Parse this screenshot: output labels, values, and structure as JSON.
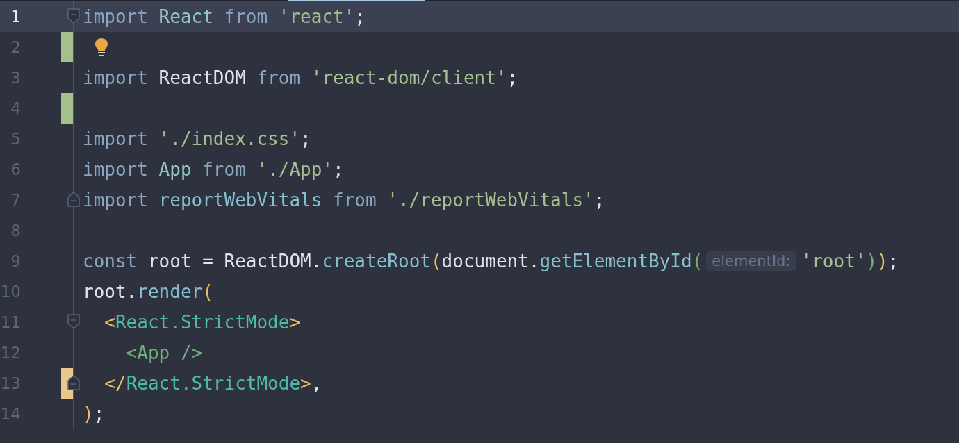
{
  "lines": [
    {
      "number": "1",
      "current": true,
      "fold_start": true,
      "fold_end": false,
      "bulb": false,
      "tokens": [
        {
          "text": "import",
          "kind": "keyword"
        },
        {
          "text": " React",
          "kind": "type"
        },
        {
          "text": " from",
          "kind": "keyword"
        },
        {
          "text": " 'react'",
          "kind": "string"
        },
        {
          "text": ";",
          "kind": "punct"
        }
      ]
    },
    {
      "number": "2",
      "current": false,
      "color": "#a4c08d",
      "fold_start": false,
      "fold_end": false,
      "bulb": true
    },
    {
      "number": "3",
      "current": false,
      "fold_start": false,
      "fold_end": false,
      "bulb": false,
      "tokens": [
        {
          "text": "import",
          "kind": "keyword"
        },
        {
          "text": " ReactDOM",
          "kind": "ident"
        },
        {
          "text": " from",
          "kind": "keyword"
        },
        {
          "text": " 'react-dom/client'",
          "kind": "string"
        },
        {
          "text": ";",
          "kind": "punct"
        }
      ]
    },
    {
      "number": "4",
      "current": false,
      "color": "#a4c08d",
      "fold_start": false,
      "fold_end": false,
      "bulb": false
    },
    {
      "number": "5",
      "current": false,
      "fold_start": false,
      "fold_end": false,
      "bulb": false,
      "tokens": [
        {
          "text": "import",
          "kind": "keyword"
        },
        {
          "text": " './index.css'",
          "kind": "string"
        },
        {
          "text": ";",
          "kind": "punct"
        }
      ]
    },
    {
      "number": "6",
      "current": false,
      "fold_start": false,
      "fold_end": false,
      "bulb": false,
      "tokens": [
        {
          "text": "import",
          "kind": "keyword"
        },
        {
          "text": " App",
          "kind": "type"
        },
        {
          "text": " from",
          "kind": "keyword"
        },
        {
          "text": " './App'",
          "kind": "string"
        },
        {
          "text": ";",
          "kind": "punct"
        }
      ]
    },
    {
      "number": "7",
      "current": false,
      "fold_start": false,
      "fold_end": true,
      "bulb": false,
      "tokens": [
        {
          "text": "import",
          "kind": "keyword"
        },
        {
          "text": " reportWebVitals",
          "kind": "func"
        },
        {
          "text": " from",
          "kind": "keyword"
        },
        {
          "text": " './reportWebVitals'",
          "kind": "string"
        },
        {
          "text": ";",
          "kind": "punct"
        }
      ]
    },
    {
      "number": "8",
      "current": false,
      "fold_start": false,
      "fold_end": false,
      "bulb": false
    },
    {
      "number": "9",
      "current": false,
      "fold_start": false,
      "fold_end": false,
      "bulb": false,
      "tokens": [
        {
          "text": "const",
          "kind": "keyword"
        },
        {
          "text": " root =",
          "kind": "ident"
        },
        {
          "text": " ReactDOM.",
          "kind": "ident"
        },
        {
          "text": "createRoot",
          "kind": "func"
        },
        {
          "text": "(",
          "kind": "paren-outer"
        },
        {
          "text": "document.",
          "kind": "ident"
        },
        {
          "text": "getElementById",
          "kind": "func"
        },
        {
          "text": "(",
          "kind": "paren-inner"
        },
        {
          "text": "elementId:",
          "kind": "hint"
        },
        {
          "text": "'root'",
          "kind": "string"
        },
        {
          "text": ")",
          "kind": "paren-inner"
        },
        {
          "text": ")",
          "kind": "paren-outer"
        },
        {
          "text": ";",
          "kind": "punct"
        }
      ]
    },
    {
      "number": "10",
      "current": false,
      "fold_start": false,
      "fold_end": false,
      "bulb": false,
      "tokens": [
        {
          "text": "root.",
          "kind": "ident"
        },
        {
          "text": "render",
          "kind": "func"
        },
        {
          "text": "(",
          "kind": "paren-outer"
        }
      ]
    },
    {
      "number": "11",
      "current": false,
      "fold_start": true,
      "fold_end": false,
      "bulb": false,
      "tokens": [
        {
          "text": "  <",
          "kind": "tag-bracket"
        },
        {
          "text": "React.StrictMode",
          "kind": "tag"
        },
        {
          "text": ">",
          "kind": "tag-bracket"
        }
      ]
    },
    {
      "number": "12",
      "current": false,
      "fold_start": false,
      "fold_end": false,
      "bulb": false,
      "tokens": [
        {
          "text": "    <App />",
          "kind": "jsx"
        }
      ]
    },
    {
      "number": "13",
      "current": false,
      "color": "#e8c98a",
      "fold_start": false,
      "fold_end": true,
      "bulb": false,
      "tokens": [
        {
          "text": "  </",
          "kind": "tag-bracket"
        },
        {
          "text": "React.StrictMode",
          "kind": "tag"
        },
        {
          "text": ">",
          "kind": "tag-bracket"
        },
        {
          "text": ",",
          "kind": "punct"
        }
      ]
    },
    {
      "number": "14",
      "current": false,
      "fold_start": false,
      "fold_end": false,
      "bulb": false,
      "tokens": [
        {
          "text": ")",
          "kind": "paren-outer"
        },
        {
          "text": ";",
          "kind": "punct"
        }
      ]
    }
  ]
}
